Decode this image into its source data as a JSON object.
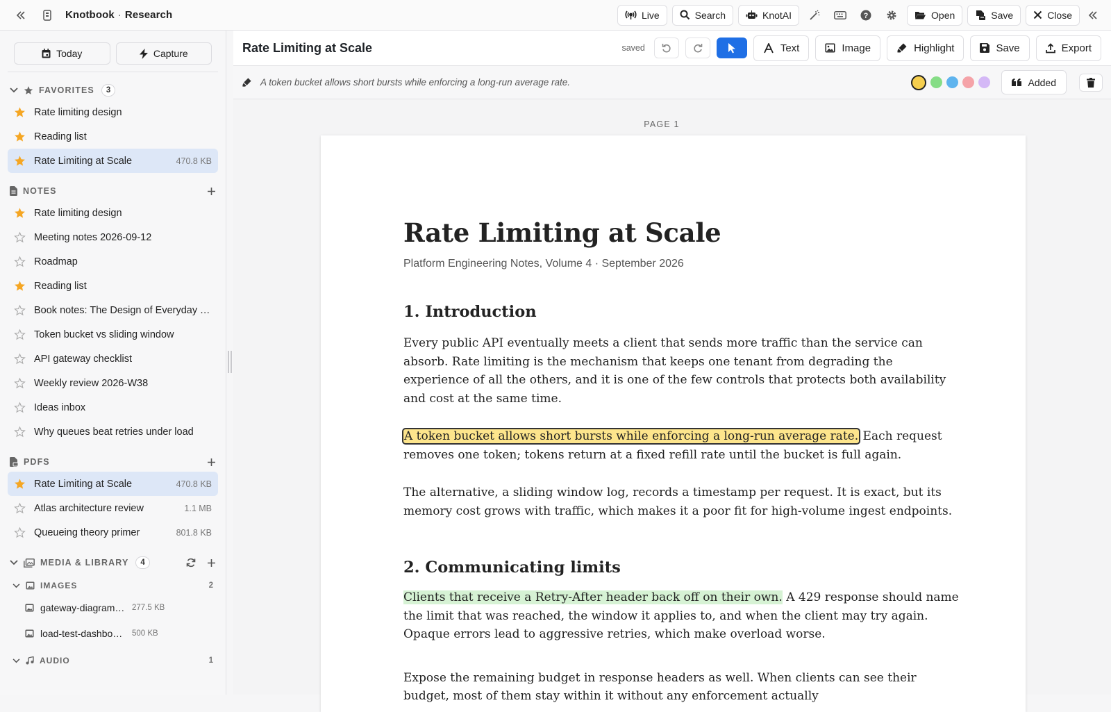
{
  "app": {
    "name": "Knotbook",
    "workspace": "Research",
    "separator": "·"
  },
  "topbar": {
    "buttons": {
      "live": "Live",
      "search": "Search",
      "knotai": "KnotAI",
      "open": "Open",
      "save": "Save",
      "close": "Close"
    }
  },
  "sidebar": {
    "quick": {
      "today": "Today",
      "capture": "Capture"
    },
    "favorites": {
      "title": "FAVORITES",
      "count": "3",
      "items": [
        {
          "label": "Rate limiting design",
          "starred": true
        },
        {
          "label": "Reading list",
          "starred": true
        },
        {
          "label": "Rate Limiting at Scale",
          "size": "470.8 KB",
          "starred": true,
          "active": true
        }
      ]
    },
    "notes": {
      "title": "NOTES",
      "items": [
        {
          "label": "Rate limiting design",
          "starred": true
        },
        {
          "label": "Meeting notes 2026-09-12",
          "starred": false
        },
        {
          "label": "Roadmap",
          "starred": false
        },
        {
          "label": "Reading list",
          "starred": true
        },
        {
          "label": "Book notes: The Design of Everyday Things",
          "starred": false
        },
        {
          "label": "Token bucket vs sliding window",
          "starred": false
        },
        {
          "label": "API gateway checklist",
          "starred": false
        },
        {
          "label": "Weekly review 2026-W38",
          "starred": false
        },
        {
          "label": "Ideas inbox",
          "starred": false
        },
        {
          "label": "Why queues beat retries under load",
          "starred": false
        }
      ]
    },
    "pdfs": {
      "title": "PDFS",
      "items": [
        {
          "label": "Rate Limiting at Scale",
          "size": "470.8 KB",
          "starred": true,
          "active": true
        },
        {
          "label": "Atlas architecture review",
          "size": "1.1 MB",
          "starred": false
        },
        {
          "label": "Queueing theory primer",
          "size": "801.8 KB",
          "starred": false
        }
      ]
    },
    "media": {
      "title": "MEDIA & LIBRARY",
      "count": "4",
      "images": {
        "title": "IMAGES",
        "count": "2",
        "items": [
          {
            "label": "gateway-diagram.png",
            "size": "277.5 KB"
          },
          {
            "label": "load-test-dashboard.png",
            "size": "500 KB"
          }
        ]
      },
      "audio": {
        "title": "AUDIO",
        "count": "1"
      }
    }
  },
  "doc": {
    "title": "Rate Limiting at Scale",
    "status": "saved",
    "tools": {
      "text": "Text",
      "image": "Image",
      "highlight": "Highlight",
      "save": "Save",
      "export": "Export"
    },
    "annotation": {
      "quote": "A token bucket allows short bursts while enforcing a long-run average rate.",
      "added_label": "Added",
      "colors": [
        "#f6cf4f",
        "#86dd86",
        "#5fb4ee",
        "#f5a3a8",
        "#d4b8f6"
      ],
      "selected_color": "#f6cf4f"
    },
    "page_label": "PAGE 1",
    "content": {
      "title": "Rate Limiting at Scale",
      "subtitle": "Platform Engineering Notes, Volume 4 · September 2026",
      "s1_heading": "1. Introduction",
      "s1_p1": "Every public API eventually meets a client that sends more traffic than the service can absorb. Rate limiting is the mechanism that keeps one tenant from degrading the experience of all the others, and it is one of the few controls that protects both availability and cost at the same time.",
      "s1_p2_highlight": "A token bucket allows short bursts while enforcing a long-run average rate.",
      "s1_p2_rest": " Each request removes one token; tokens return at a fixed refill rate until the bucket is full again.",
      "s1_p3": "The alternative, a sliding window log, records a timestamp per request. It is exact, but its memory cost grows with traffic, which makes it a poor fit for high-volume ingest endpoints.",
      "s2_heading": "2. Communicating limits",
      "s2_p1_highlight": "Clients that receive a Retry-After header back off on their own.",
      "s2_p1_rest": " A 429 response should name the limit that was reached, the window it applies to, and when the client may try again. Opaque errors lead to aggressive retries, which make overload worse.",
      "s2_p2": "Expose the remaining budget in response headers as well. When clients can see their budget, most of them stay within it without any enforcement actually"
    }
  }
}
